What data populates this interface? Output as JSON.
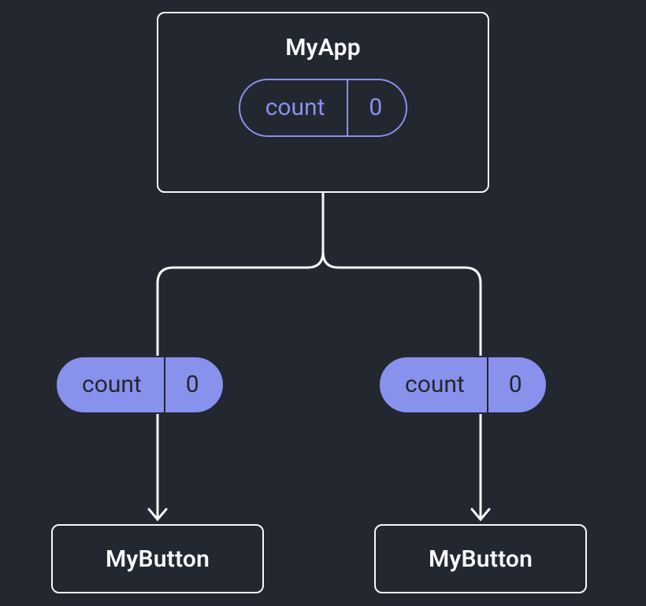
{
  "root": {
    "title": "MyApp",
    "state": {
      "label": "count",
      "value": "0"
    }
  },
  "props": {
    "left": {
      "label": "count",
      "value": "0"
    },
    "right": {
      "label": "count",
      "value": "0"
    }
  },
  "children": {
    "left": {
      "title": "MyButton"
    },
    "right": {
      "title": "MyButton"
    }
  },
  "colors": {
    "background": "#23272f",
    "node_stroke": "#f7f8fa",
    "accent": "#8891ec"
  }
}
